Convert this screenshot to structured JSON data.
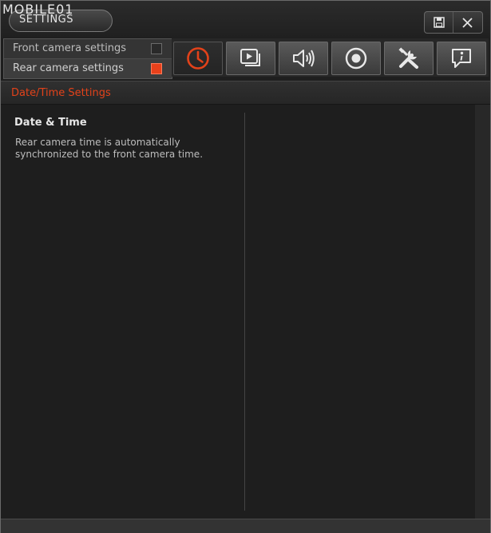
{
  "title_bar": {
    "logo_text": "MOBILE01",
    "settings_label": "SETTINGS"
  },
  "camera_selector": {
    "items": [
      {
        "label": "Front camera settings",
        "selected": false
      },
      {
        "label": "Rear camera settings",
        "selected": true
      }
    ],
    "selected_color": "#e8411b"
  },
  "toolbar": {
    "buttons": [
      {
        "icon": "clock-icon",
        "active": true
      },
      {
        "icon": "video-playback-icon",
        "active": false
      },
      {
        "icon": "speaker-icon",
        "active": false
      },
      {
        "icon": "record-icon",
        "active": false
      },
      {
        "icon": "tools-icon",
        "active": false
      },
      {
        "icon": "info-icon",
        "active": false
      }
    ],
    "active_color": "#e2421a"
  },
  "section": {
    "title": "Date/Time Settings"
  },
  "content": {
    "item_title": "Date & Time",
    "item_desc": "Rear camera time is automatically synchronized to the front camera time."
  }
}
